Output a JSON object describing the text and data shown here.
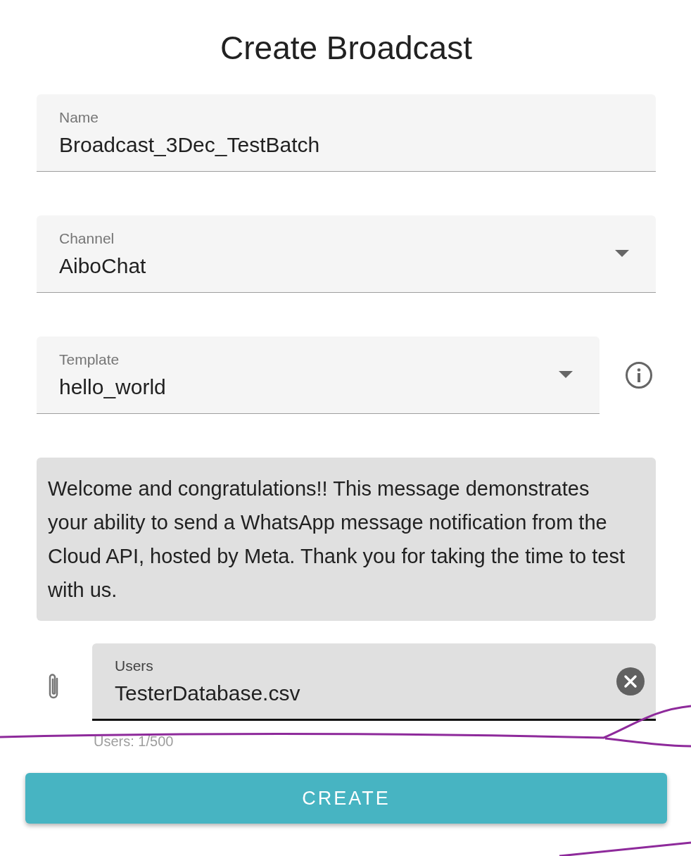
{
  "title": "Create Broadcast",
  "fields": [
    {
      "kind": "text",
      "label": "Name",
      "value": "Broadcast_3Dec_TestBatch"
    },
    {
      "kind": "select",
      "label": "Channel",
      "value": "AiboChat"
    },
    {
      "kind": "select",
      "label": "Template",
      "value": "hello_world",
      "info": true
    }
  ],
  "message": "Welcome and congratulations!! This message demonstrates your ability to send a WhatsApp message notification from the Cloud API, hosted by Meta. Thank you for taking the time to test with us.",
  "users": {
    "label": "Users",
    "value": "TesterDatabase.csv",
    "helper": "Users: 1/500"
  },
  "button": "CREATE"
}
